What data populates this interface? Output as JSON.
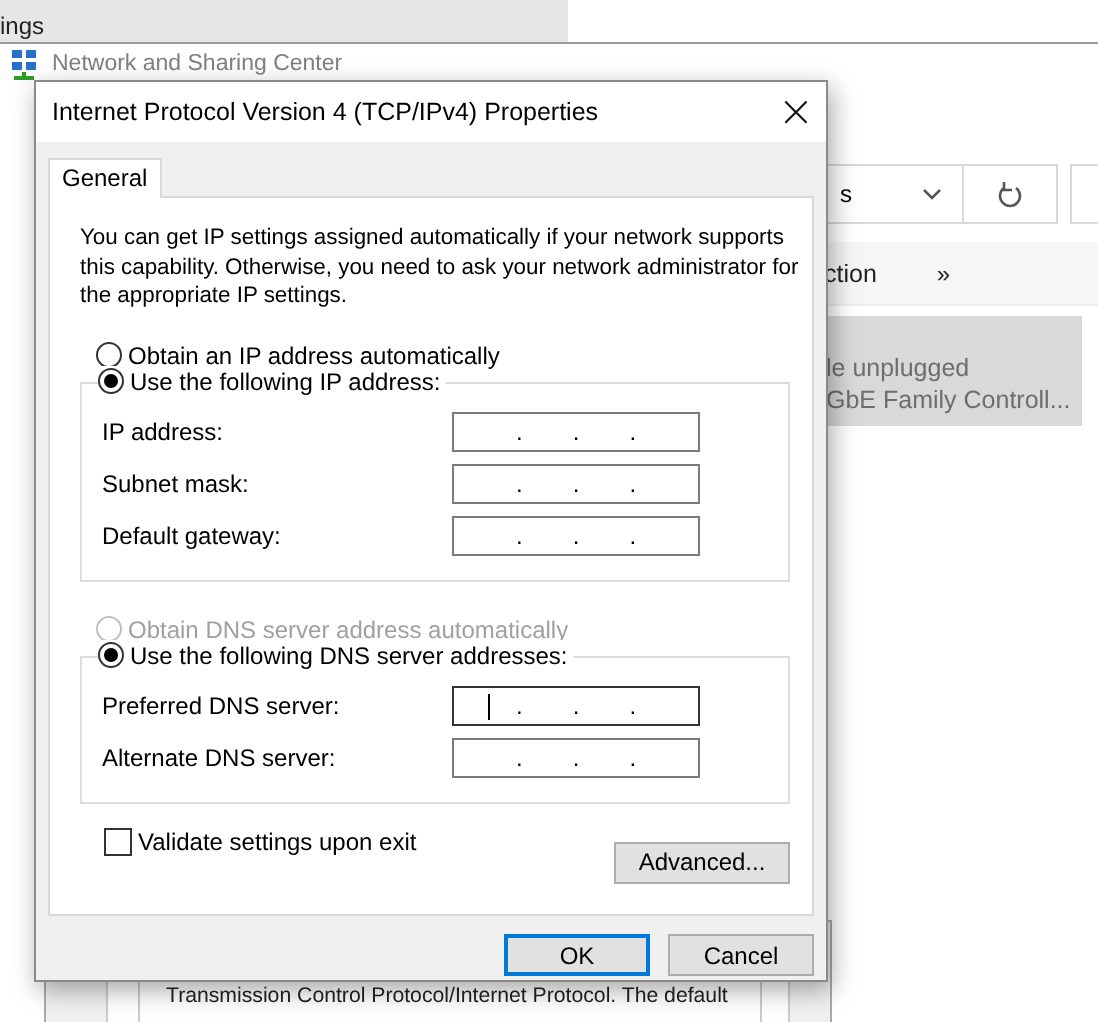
{
  "settings_window": {
    "title": "ings"
  },
  "network_window": {
    "title": "Network and Sharing Center",
    "address_text": "s",
    "toolbar_text": "ction",
    "toolbar_more": "»",
    "adapter": {
      "selected": true,
      "lines": [
        "le unplugged",
        "GbE Family Controll..."
      ]
    }
  },
  "properties_window": {
    "description": "Transmission Control Protocol/Internet Protocol. The default"
  },
  "dialog": {
    "title": "Internet Protocol Version 4 (TCP/IPv4) Properties",
    "close": "×",
    "tabs": [
      {
        "label": "General",
        "selected": true
      }
    ],
    "description": "You can get IP settings assigned automatically if your network supports this capability. Otherwise, you need to ask your network administrator for the appropriate IP settings.",
    "ip_options": [
      {
        "label": "Obtain an IP address automatically",
        "selected": false,
        "disabled": false
      },
      {
        "label": "Use the following IP address:",
        "selected": true,
        "disabled": false
      }
    ],
    "ip_fields": [
      {
        "label": "IP address:",
        "separators": [
          ".",
          ".",
          "."
        ],
        "focused": false
      },
      {
        "label": "Subnet mask:",
        "separators": [
          ".",
          ".",
          "."
        ],
        "focused": false
      },
      {
        "label": "Default gateway:",
        "separators": [
          ".",
          ".",
          "."
        ],
        "focused": false
      }
    ],
    "dns_options": [
      {
        "label": "Obtain DNS server address automatically",
        "selected": false,
        "disabled": true
      },
      {
        "label": "Use the following DNS server addresses:",
        "selected": true,
        "disabled": false
      }
    ],
    "dns_fields": [
      {
        "label": "Preferred DNS server:",
        "separators": [
          ".",
          ".",
          "."
        ],
        "focused": true
      },
      {
        "label": "Alternate DNS server:",
        "separators": [
          ".",
          ".",
          "."
        ],
        "focused": false
      }
    ],
    "validate": {
      "label": "Validate settings upon exit",
      "checked": false
    },
    "advanced_button": "Advanced...",
    "buttons": [
      {
        "label": "OK",
        "default": true
      },
      {
        "label": "Cancel",
        "default": false
      }
    ]
  }
}
